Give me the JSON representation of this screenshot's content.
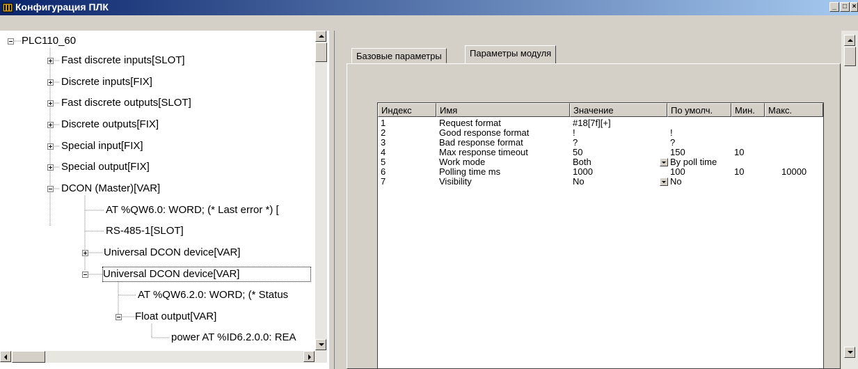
{
  "window": {
    "title": "Конфигурация ПЛК",
    "min_glyph": "_",
    "max_glyph": "□",
    "close_glyph": "×"
  },
  "tree": {
    "root": "PLC110_60",
    "items": [
      "Fast discrete inputs[SLOT]",
      "Discrete inputs[FIX]",
      "Fast discrete outputs[SLOT]",
      "Discrete outputs[FIX]",
      "Special input[FIX]",
      "Special output[FIX]",
      "DCON (Master)[VAR]",
      "AT %QW6.0: WORD; (* Last error *) [",
      "RS-485-1[SLOT]",
      "Universal DCON device[VAR]",
      "Universal DCON device[VAR]",
      "AT %QW6.2.0: WORD; (* Status",
      "Float output[VAR]",
      "power AT %ID6.2.0.0: REA"
    ]
  },
  "tabs": [
    "Базовые параметры",
    "Параметры модуля"
  ],
  "grid": {
    "headers": [
      "Индекс",
      "Имя",
      "Значение",
      "По умолч.",
      "Мин.",
      "Макс."
    ],
    "rows": [
      [
        "1",
        "Request format",
        "#18[7f][+]",
        "",
        "",
        ""
      ],
      [
        "2",
        "Good response format",
        "!",
        "!",
        "",
        ""
      ],
      [
        "3",
        "Bad response format",
        "?",
        "?",
        "",
        ""
      ],
      [
        "4",
        "Max response timeout",
        "50",
        "150",
        "10",
        ""
      ],
      [
        "5",
        "Work mode",
        "Both",
        "By poll time",
        "",
        ""
      ],
      [
        "6",
        "Polling time ms",
        "1000",
        "100",
        "10",
        "10000"
      ],
      [
        "7",
        "Visibility",
        "No",
        "No",
        "",
        ""
      ]
    ]
  },
  "colors": {
    "title_bar_start": "#0a246a",
    "title_bar_end": "#a6caf0",
    "face": "#d4d0c8"
  }
}
